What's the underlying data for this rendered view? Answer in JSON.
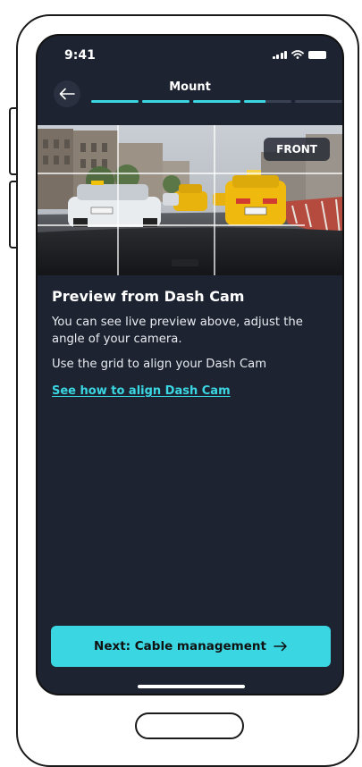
{
  "status_bar": {
    "time": "9:41"
  },
  "header": {
    "title": "Mount",
    "progress_steps": [
      1,
      1,
      1,
      0.45,
      0
    ]
  },
  "preview": {
    "camera_label": "FRONT"
  },
  "content": {
    "title": "Preview from Dash Cam",
    "description": "You can see live preview above, adjust the angle of your camera.",
    "instruction": "Use the grid to align your Dash Cam",
    "link_label": "See how to align Dash Cam"
  },
  "footer": {
    "next_label": "Next: Cable management"
  },
  "colors": {
    "accent": "#3ad7e3",
    "background": "#1e2331"
  },
  "icons": {
    "back": "arrow-left-icon",
    "next": "arrow-right-icon",
    "signal": "signal-icon",
    "wifi": "wifi-icon",
    "battery": "battery-icon"
  }
}
